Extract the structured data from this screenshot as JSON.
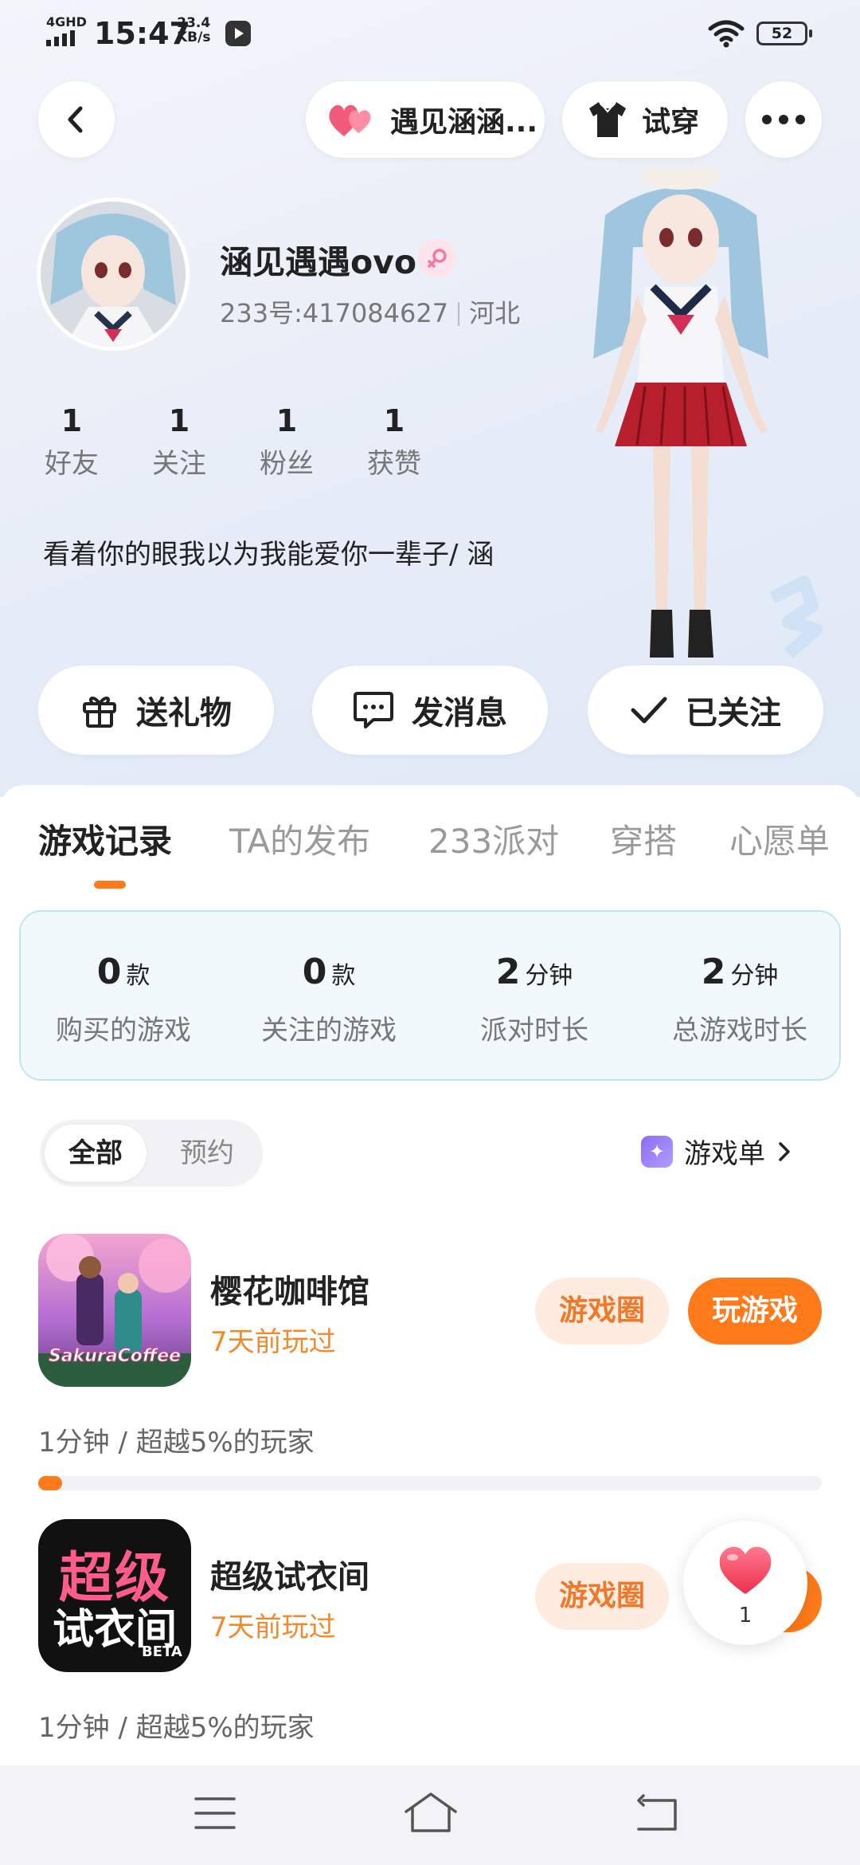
{
  "status_bar": {
    "network": "4GHD",
    "time": "15:47",
    "speed_value": "23.4",
    "speed_unit": "KB/s",
    "battery": "52"
  },
  "top_bar": {
    "back_icon": "chevron-left-icon",
    "meet_label": "遇见涵涵...",
    "tryon_label": "试穿",
    "more_icon": "more-dots-icon"
  },
  "profile": {
    "name": "涵见遇遇ovo",
    "gender_icon": "female-icon",
    "uid": "233号:417084627",
    "region": "河北",
    "stats": [
      {
        "value": "1",
        "label": "好友"
      },
      {
        "value": "1",
        "label": "关注"
      },
      {
        "value": "1",
        "label": "粉丝"
      },
      {
        "value": "1",
        "label": "获赞"
      }
    ],
    "bio": "看着你的眼我以为我能爱你一辈子/  涵"
  },
  "actions": {
    "gift": "送礼物",
    "message": "发消息",
    "following": "已关注"
  },
  "tabs": [
    "游戏记录",
    "TA的发布",
    "233派对",
    "穿搭",
    "心愿单"
  ],
  "summary": [
    {
      "value": "0",
      "unit": "款",
      "label": "购买的游戏"
    },
    {
      "value": "0",
      "unit": "款",
      "label": "关注的游戏"
    },
    {
      "value": "2",
      "unit": "分钟",
      "label": "派对时长"
    },
    {
      "value": "2",
      "unit": "分钟",
      "label": "总游戏时长"
    }
  ],
  "filter": {
    "all": "全部",
    "reserved": "预约",
    "game_list": "游戏单"
  },
  "games": [
    {
      "title": "樱花咖啡馆",
      "icon_text": "SakuraCoffee",
      "played": "7天前玩过",
      "circle": "游戏圈",
      "play": "玩游戏",
      "stat": "1分钟 / 超越5%的玩家",
      "progress": 0.03
    },
    {
      "title": "超级试衣间",
      "icon_line1": "超级",
      "icon_line2": "试衣间",
      "icon_beta": "BETA",
      "played": "7天前玩过",
      "circle": "游戏圈",
      "stat": "1分钟 / 超越5%的玩家"
    }
  ],
  "like": {
    "icon": "heart-icon",
    "count": "1"
  },
  "colors": {
    "accent": "#ff7a1a",
    "accent_soft": "#fdecdf",
    "card_border": "#bfe6ef"
  }
}
